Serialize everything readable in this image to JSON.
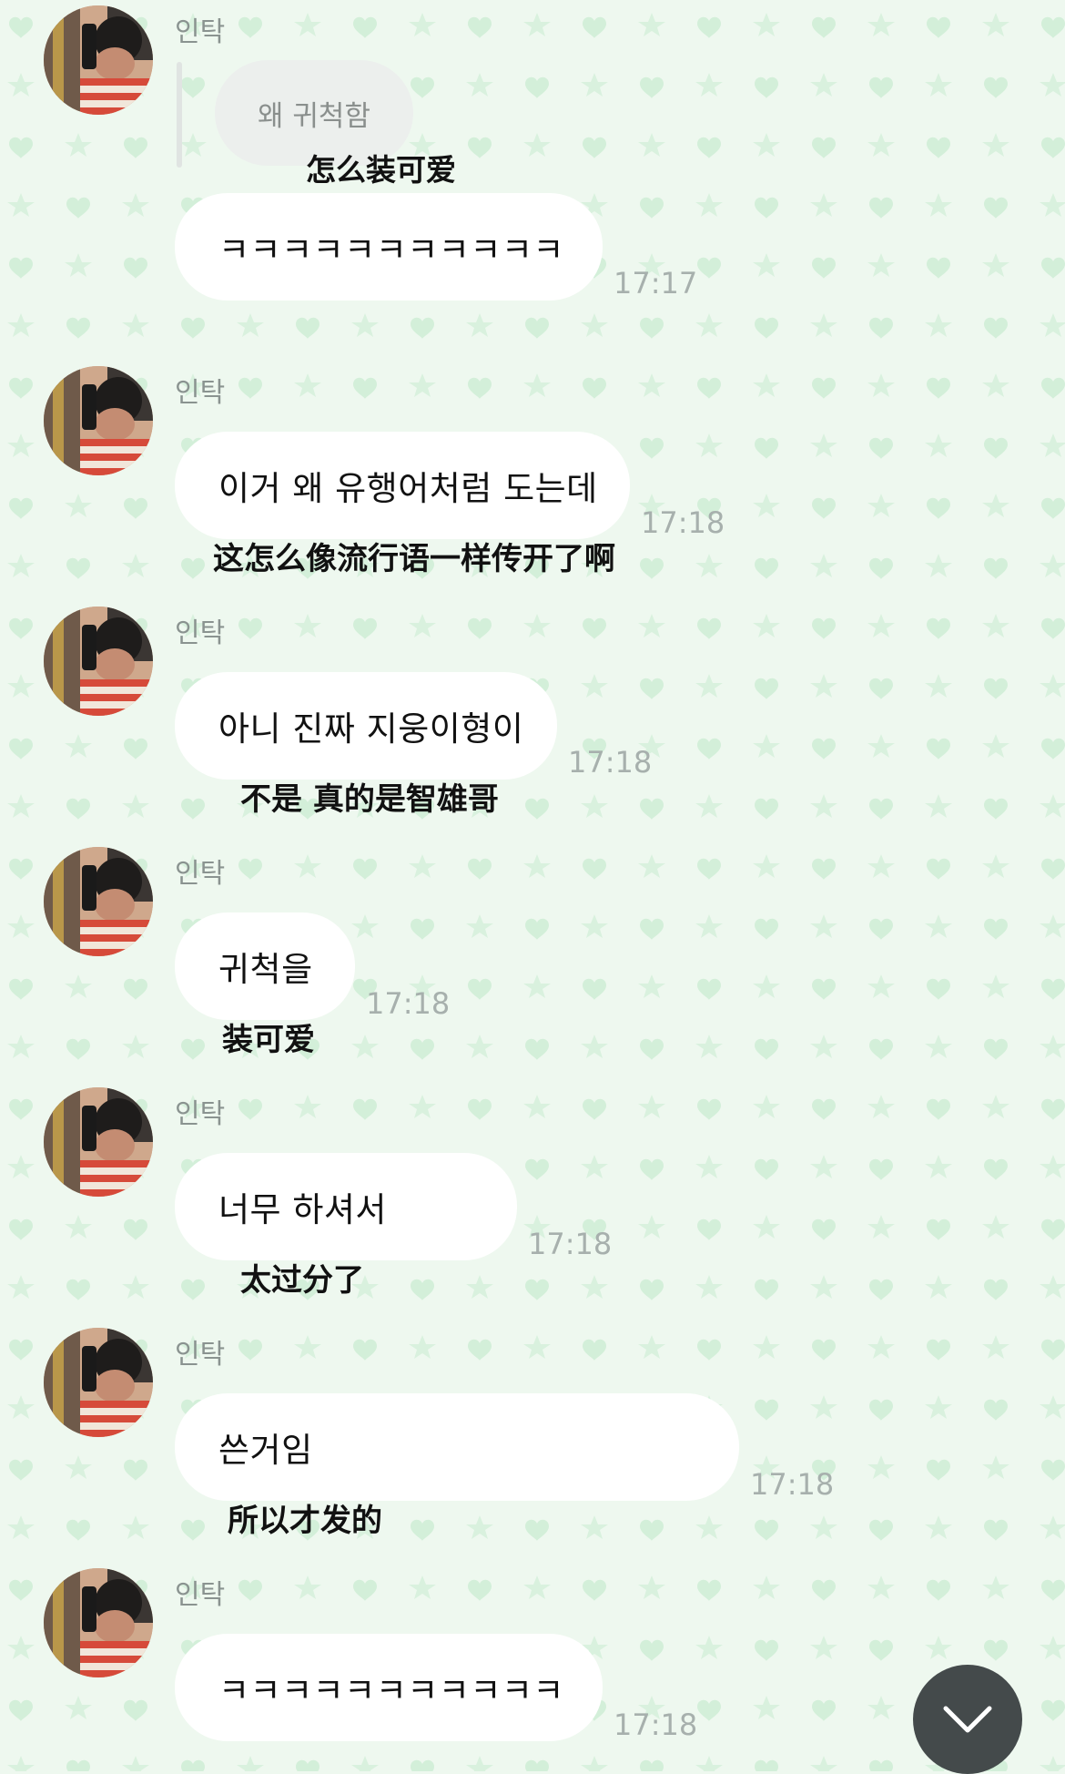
{
  "theme": {
    "background": "#eef8ef",
    "pattern_color": "#d3efd9",
    "bubble": "#ffffff",
    "time_color": "#a7b0ad",
    "scroll_button": "#444a4b"
  },
  "messages": [
    {
      "sender": "인탁",
      "quote": "왜 귀척함",
      "quote_translation": "怎么装可爱",
      "text": "ㅋㅋㅋㅋㅋㅋㅋㅋㅋㅋㅋ",
      "time": "17:17"
    },
    {
      "sender": "인탁",
      "text": "이거 왜 유행어처럼 도는데",
      "time": "17:18",
      "translation": "这怎么像流行语一样传开了啊"
    },
    {
      "sender": "인탁",
      "text": "아니 진짜 지웅이형이",
      "time": "17:18",
      "translation": "不是 真的是智雄哥"
    },
    {
      "sender": "인탁",
      "text": "귀척을",
      "time": "17:18",
      "translation": "装可爱"
    },
    {
      "sender": "인탁",
      "text": "너무 하셔서",
      "time": "17:18",
      "translation": "太过分了"
    },
    {
      "sender": "인탁",
      "text": "쓴거임",
      "time": "17:18",
      "translation": "所以才发的"
    },
    {
      "sender": "인탁",
      "text": "ㅋㅋㅋㅋㅋㅋㅋㅋㅋㅋㅋ",
      "time": "17:18"
    }
  ],
  "scroll_button": {
    "icon": "chevron-down-icon"
  }
}
